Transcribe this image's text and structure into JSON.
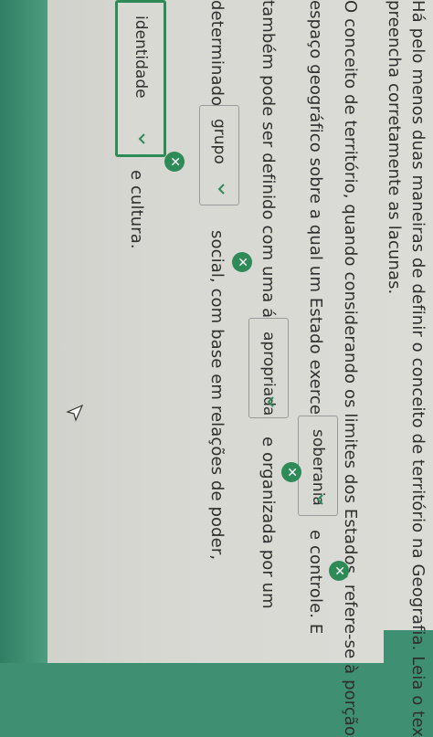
{
  "instructions": {
    "line1": "Há pelo menos duas maneiras de definir o conceito de território na Geografia. Leia o tex",
    "line2": "preencha corretamente as lacunas."
  },
  "paragraph": {
    "line1": "O conceito de território, quando considerando os limites dos Estados, refere-se à porção",
    "line2_before": "espaço geográfico sobre a qual um Estado exerce sua",
    "line2_after": "e controle. E",
    "line3_before": "também pode ser definido com uma área",
    "line3_after": "e organizada por um",
    "line4_before": "determinado",
    "line4_after": "social, com base em relações de poder,",
    "line5_after": "e cultura."
  },
  "dropdowns": [
    {
      "value": "soberania"
    },
    {
      "value": "apropriada"
    },
    {
      "value": "grupo"
    },
    {
      "value": "identidade"
    }
  ],
  "badge_symbol": "✕",
  "colors": {
    "accent_green": "#2e8b57",
    "page_bg": "#d9d9d4",
    "side_strip": "#3f8f73"
  }
}
